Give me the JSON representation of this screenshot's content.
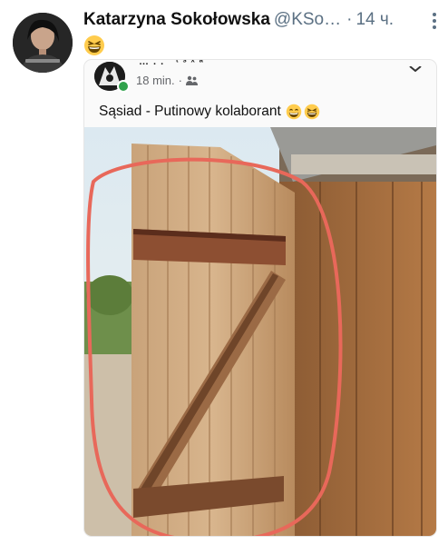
{
  "tweet": {
    "display_name": "Katarzyna Sokołowska",
    "handle": "@KSo…",
    "separator": "·",
    "time": "14 ч.",
    "avatar_icon": "profile-photo",
    "emoji": "grinning-squinting-face"
  },
  "embed": {
    "author_name_cut": "… . . ˙ ᵗ ˢ ˣ ᵃ",
    "time": "18 min.",
    "separator": "·",
    "audience_icon": "friends-icon",
    "post_text": "Sąsiad - Putinowy kolaborant",
    "post_emojis": [
      "beaming-face-with-smiling-eyes",
      "grinning-squinting-face"
    ],
    "photo_description_icon": "wooden-outhouse-door-photo"
  },
  "colors": {
    "name": "#111111",
    "muted": "#5b7083",
    "fb_muted": "#65676b",
    "online_dot": "#31a24c",
    "red_circle": "#e8685a"
  }
}
